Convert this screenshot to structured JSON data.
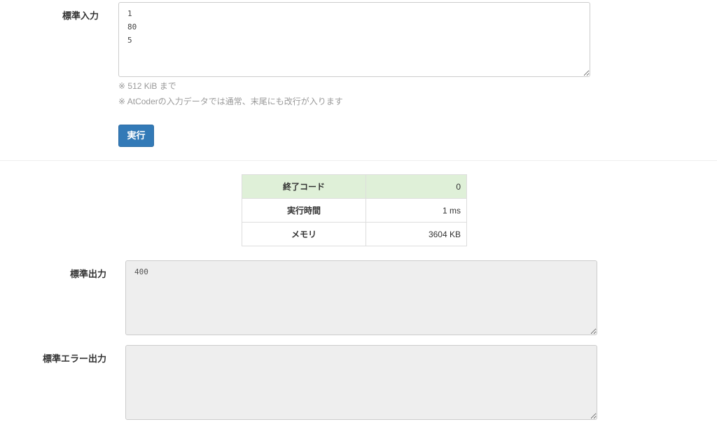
{
  "stdin": {
    "label": "標準入力",
    "value": "1\n80\n5",
    "notes": [
      "※ 512 KiB まで",
      "※ AtCoderの入力データでは通常、末尾にも改行が入ります"
    ]
  },
  "run_button": {
    "label": "実行"
  },
  "result": {
    "rows": [
      {
        "key": "終了コード",
        "value": "0"
      },
      {
        "key": "実行時間",
        "value": "1 ms"
      },
      {
        "key": "メモリ",
        "value": "3604 KB"
      }
    ],
    "success_color": "#dff0d8"
  },
  "stdout": {
    "label": "標準出力",
    "value": "400"
  },
  "stderr": {
    "label": "標準エラー出力",
    "value": ""
  },
  "colors": {
    "primary_button": "#337ab7",
    "readonly_bg": "#eeeeee"
  }
}
